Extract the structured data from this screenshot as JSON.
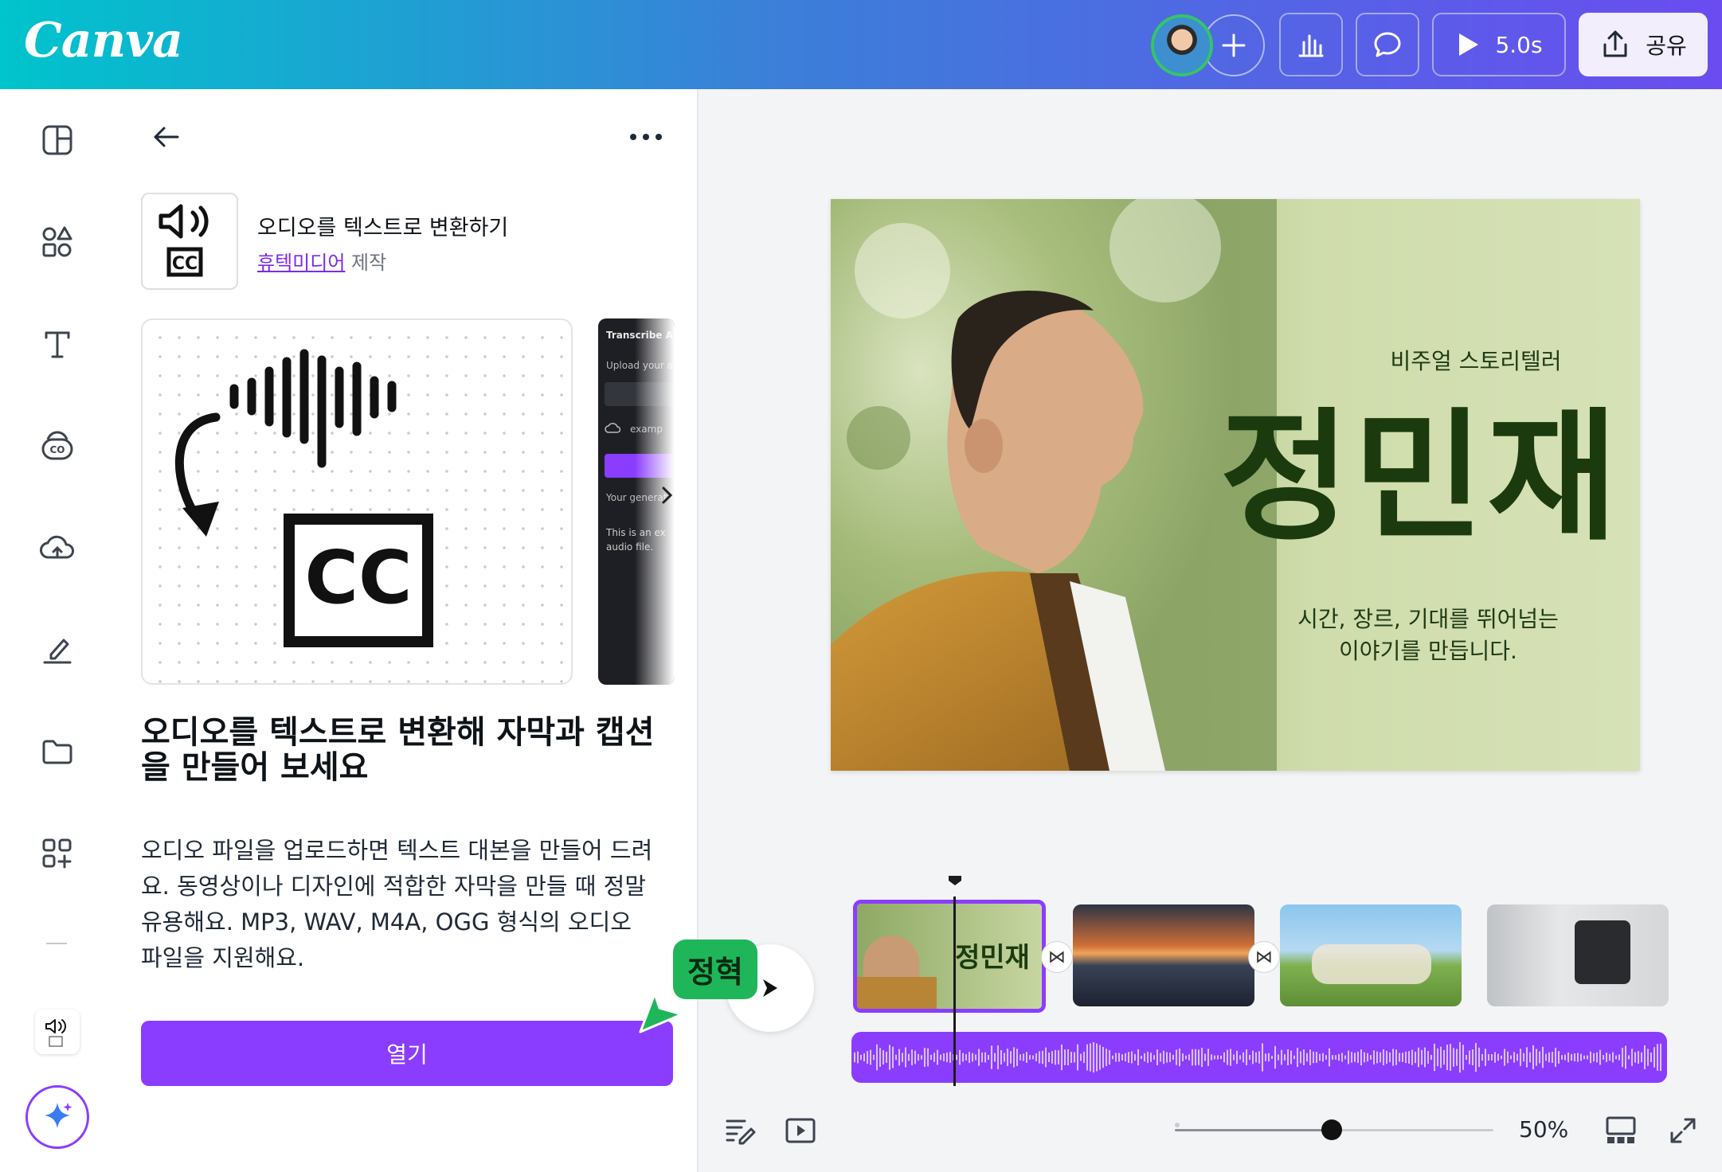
{
  "app": {
    "logo": "Canva"
  },
  "header": {
    "play_duration": "5.0s",
    "share_label": "공유"
  },
  "panel": {
    "app_name": "오디오를 텍스트로 변환하기",
    "maker_name": "휴텍미디어",
    "maker_suffix": " 제작",
    "preview2": {
      "title": "Transcribe A",
      "upload": "Upload your a",
      "example": "examp",
      "generated": "Your generat",
      "sample_line1": "This is an ex",
      "sample_line2": "audio file."
    },
    "headline": "오디오를 텍스트로 변환해 자막과 캡션을 만들어 보세요",
    "description": "오디오 파일을 업로드하면 텍스트 대본을 만들어 드려요. 동영상이나 디자인에 적합한 자막을 만들 때 정말 유용해요. MP3, WAV, M4A, OGG 형식의 오디오 파일을 지원해요.",
    "open_button": "열기"
  },
  "slide": {
    "subtitle": "비주얼 스토리텔러",
    "name": "정민재",
    "tagline_line1": "시간, 장르, 기대를 뛰어넘는",
    "tagline_line2": "이야기를 만듭니다."
  },
  "timeline": {
    "thumb1_name": "정민재"
  },
  "footer": {
    "zoom": "50%",
    "zoom_level": 0.5
  },
  "collaborator": {
    "name": "정혁"
  },
  "colors": {
    "accent": "#8b3dff",
    "slide_text": "#1b3b0f",
    "collab": "#1fb65a"
  }
}
